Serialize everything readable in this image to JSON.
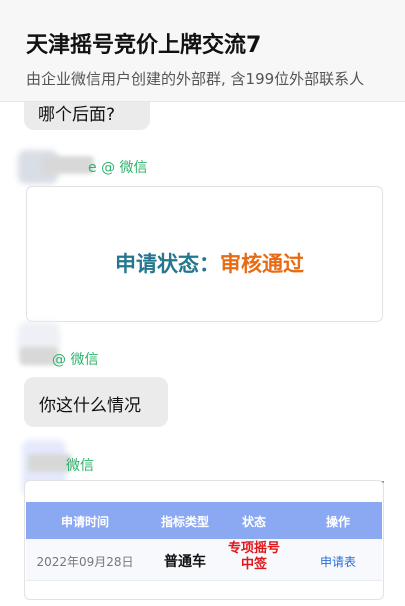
{
  "header": {
    "title": "天津摇号竞价上牌交流7",
    "subtitle": "由企业微信用户创建的外部群, 含199位外部联系人"
  },
  "messages": [
    {
      "text": "哪个后面?"
    },
    {
      "sender_suffix": "e @ 微信",
      "image": {
        "label": "申请状态：",
        "value": "审核通过"
      }
    },
    {
      "sender_suffix": "@ 微信",
      "text": "你这什么情况"
    },
    {
      "sender_suffix": "微信",
      "table": {
        "headers": [
          "申请时间",
          "指标类型",
          "状态",
          "操作"
        ],
        "row": {
          "date": "2022年09月28日",
          "type": "普通车",
          "status": "专项摇号中签",
          "action": "申请表"
        }
      }
    }
  ],
  "colors": {
    "accent_green": "#2db36b",
    "status_label": "#24778f",
    "status_value": "#e86a12",
    "table_header": "#8ba8f2",
    "status_red": "#e0161b",
    "link_blue": "#2a6fd6"
  }
}
